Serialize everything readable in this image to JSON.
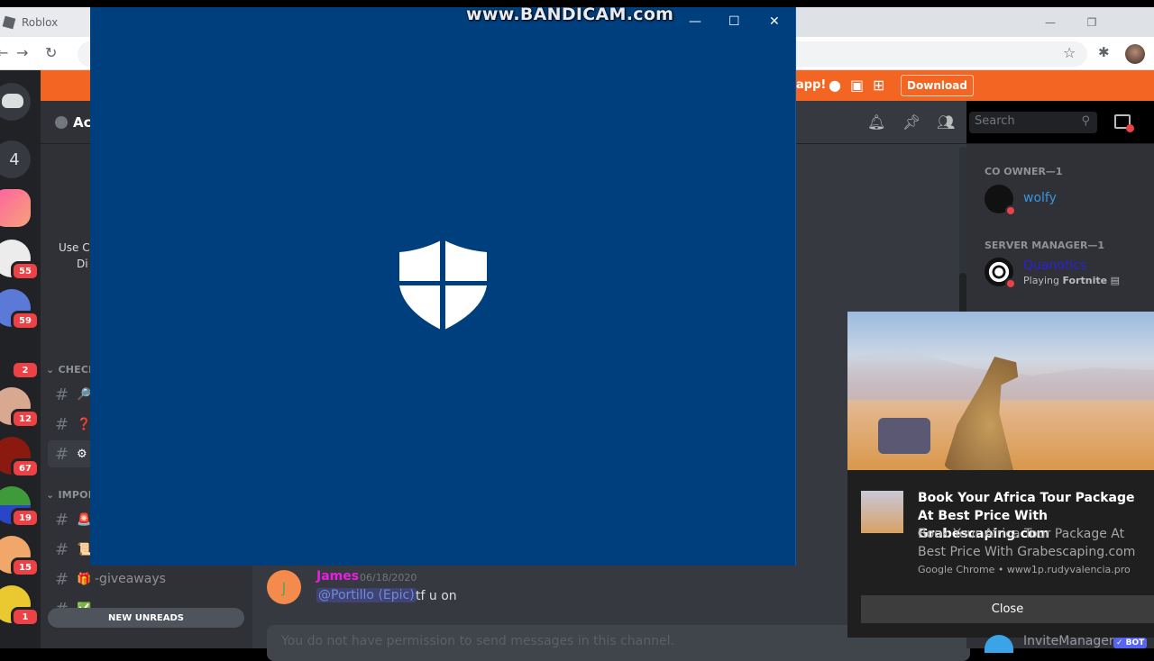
{
  "browser": {
    "tab_title": "Roblox",
    "nav": {
      "back": "←",
      "forward": "→",
      "reload": "↻"
    },
    "icons": {
      "star": "☆",
      "extensions": "puzzle-icon",
      "profile": "avatar"
    },
    "window_controls": {
      "minimize": "—",
      "restore": "❐"
    }
  },
  "promo_bar": {
    "text": "app!",
    "platforms": [
      "apple",
      "android",
      "windows"
    ],
    "download_label": "Download",
    "color": "#f26522"
  },
  "discord": {
    "server_badge_count": "4",
    "guild_badges": [
      "55",
      "59",
      "2",
      "12",
      "67",
      "19",
      "15",
      "1"
    ],
    "server_name_partial": "Ac",
    "use_text_lines": [
      "Use C",
      "Di"
    ],
    "categories": [
      {
        "label": "CHECKI",
        "channels": [
          {
            "emoji": "🔎",
            "name": ""
          },
          {
            "emoji": "❓",
            "name": ""
          },
          {
            "emoji": "⚙",
            "name": "",
            "active": true
          }
        ]
      },
      {
        "label": "IMPORT",
        "channels": [
          {
            "emoji": "🚨",
            "name": ""
          },
          {
            "emoji": "📜",
            "name": ""
          },
          {
            "emoji": "🎁",
            "name": "-giveaways"
          },
          {
            "emoji": "✅",
            "name": ""
          }
        ]
      }
    ],
    "new_unreads_label": "NEW UNREADS",
    "search_placeholder": "Search",
    "header_icons": [
      "bell-icon",
      "pin-icon",
      "members-icon",
      "inbox-icon"
    ],
    "message": {
      "avatar_letter": "J",
      "author": "James",
      "timestamp": "06/18/2020",
      "mention": "@Portillo (Epic)",
      "text": "tf u on"
    },
    "input_placeholder": "You do not have permission to send messages in this channel.",
    "members": [
      {
        "category": "CO OWNER—1",
        "name": "wolfy",
        "name_color": "#3a94dc",
        "status": "dnd"
      },
      {
        "category": "SERVER MANAGER—1",
        "name": "Quanotics",
        "name_color": "#2d1fe0",
        "activity_prefix": "Playing ",
        "activity": "Fortnite",
        "status": "dnd"
      }
    ],
    "bottom_member": {
      "name": "InviteManager",
      "badge": "✓ BOT"
    }
  },
  "defender_window": {
    "controls": {
      "minimize": "—",
      "maximize": "☐",
      "close": "✕"
    },
    "bg_color": "#003f7e",
    "watermark": "www.BANDICAM.com"
  },
  "toast": {
    "title": "Book Your Africa Tour Package At Best Price With Grabescaping.com",
    "body": "Book Your Africa Tour Package At Best Price With Grabescaping.com",
    "source": "Google Chrome • www1p.rudyvalencia.pro",
    "close_label": "Close"
  }
}
